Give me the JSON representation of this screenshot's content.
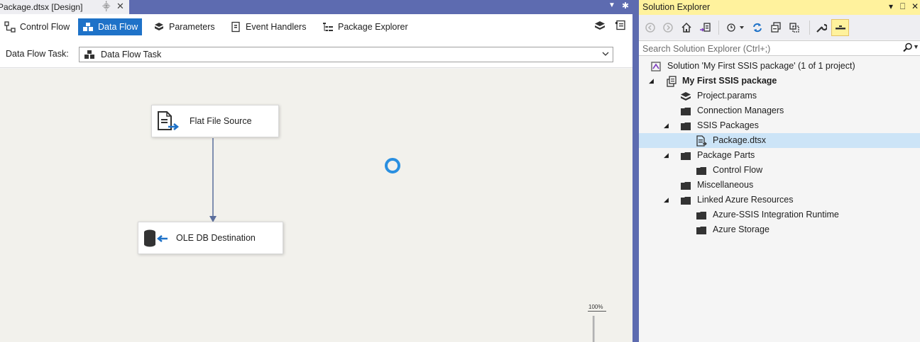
{
  "designer": {
    "doc_tab_title": "Package.dtsx [Design]",
    "doc_tab_pin": "⸎",
    "doc_tab_close": "✕",
    "tabs": [
      {
        "label": "Control Flow",
        "icon": "control-flow-icon",
        "active": false
      },
      {
        "label": "Data Flow",
        "icon": "data-flow-icon",
        "active": true
      },
      {
        "label": "Parameters",
        "icon": "parameters-icon",
        "active": false
      },
      {
        "label": "Event Handlers",
        "icon": "event-handlers-icon",
        "active": false
      },
      {
        "label": "Package Explorer",
        "icon": "package-explorer-icon",
        "active": false
      }
    ],
    "task_label": "Data Flow Task:",
    "task_value": "Data Flow Task",
    "components": [
      {
        "label": "Flat File Source",
        "icon": "flat-file-source-icon"
      },
      {
        "label": "OLE DB Destination",
        "icon": "ole-db-destination-icon"
      }
    ],
    "zoom_label": "100%",
    "accent_color": "#1e72c8",
    "tab_strip_color": "#5d6bb0"
  },
  "solution_explorer": {
    "title": "Solution Explorer",
    "title_bar_color": "#fff29d",
    "window_buttons": [
      "▾",
      "⎕",
      "✕"
    ],
    "search_placeholder": "Search Solution Explorer (Ctrl+;)",
    "tree": [
      {
        "label": "Solution 'My First SSIS package' (1 of 1 project)",
        "icon": "solution-icon",
        "bold": false,
        "expander": "",
        "level": 0,
        "selected": false
      },
      {
        "label": "My First SSIS package",
        "icon": "ssis-project-icon",
        "bold": true,
        "expander": "◢",
        "level": 0,
        "selected": false
      },
      {
        "label": "Project.params",
        "icon": "params-icon",
        "bold": false,
        "expander": "",
        "level": 1,
        "selected": false
      },
      {
        "label": "Connection Managers",
        "icon": "folder-icon",
        "bold": false,
        "expander": "",
        "level": 1,
        "selected": false
      },
      {
        "label": "SSIS Packages",
        "icon": "folder-icon",
        "bold": false,
        "expander": "◢",
        "level": 1,
        "selected": false
      },
      {
        "label": "Package.dtsx",
        "icon": "package-file-icon",
        "bold": false,
        "expander": "",
        "level": 2,
        "selected": true
      },
      {
        "label": "Package Parts",
        "icon": "folder-icon",
        "bold": false,
        "expander": "◢",
        "level": 1,
        "selected": false
      },
      {
        "label": "Control Flow",
        "icon": "folder-icon",
        "bold": false,
        "expander": "",
        "level": 2,
        "selected": false
      },
      {
        "label": "Miscellaneous",
        "icon": "folder-icon",
        "bold": false,
        "expander": "",
        "level": 1,
        "selected": false
      },
      {
        "label": "Linked Azure Resources",
        "icon": "folder-icon",
        "bold": false,
        "expander": "◢",
        "level": 1,
        "selected": false
      },
      {
        "label": "Azure-SSIS Integration Runtime",
        "icon": "folder-icon",
        "bold": false,
        "expander": "",
        "level": 2,
        "selected": false
      },
      {
        "label": "Azure Storage",
        "icon": "folder-icon",
        "bold": false,
        "expander": "",
        "level": 2,
        "selected": false
      }
    ]
  }
}
